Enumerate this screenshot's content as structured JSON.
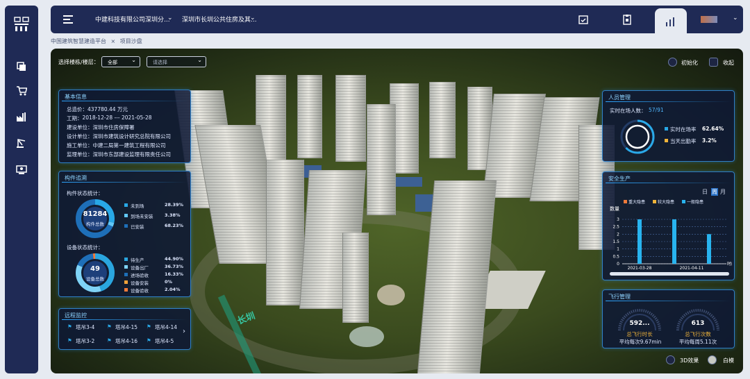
{
  "topbar": {
    "company": "中建科技有限公司深圳分...",
    "project": "深圳市长圳公共住房及其...",
    "user_name": ""
  },
  "breadcrumb": {
    "root": "中国建筑智慧建造平台",
    "sep": "×",
    "current": "项目沙盘"
  },
  "filter": {
    "label": "选择楼栋/楼层：",
    "building_value": "全部",
    "floor_placeholder": "请选择"
  },
  "controls": {
    "init_label": "初始化",
    "collapse_label": "收起",
    "effect_label": "3D效果",
    "white_label": "白模"
  },
  "basic_info": {
    "title": "基本信息",
    "rows": [
      {
        "k": "总造价：",
        "v": "437780.44 万元"
      },
      {
        "k": "工期：",
        "v": "2018-12-28 --- 2021-05-28"
      },
      {
        "k": "建设单位：",
        "v": "深圳市住房保障署"
      },
      {
        "k": "设计单位：",
        "v": "深圳市建筑设计研究总院有限公司"
      },
      {
        "k": "施工单位：",
        "v": "中建二局第一建筑工程有限公司"
      },
      {
        "k": "监理单位：",
        "v": "深圳市东部建设监理有限责任公司"
      }
    ]
  },
  "components": {
    "title": "构件追溯",
    "comp_label": "构件状态统计：",
    "comp_total": "81284",
    "comp_total_label": "构件总数",
    "comp_items": [
      {
        "name": "未到场",
        "pct": "28.39%",
        "color": "#28a8e6"
      },
      {
        "name": "到场未安装",
        "pct": "3.38%",
        "color": "#62c8f7"
      },
      {
        "name": "已安装",
        "pct": "68.23%",
        "color": "#1e6fb8"
      }
    ],
    "equip_label": "设备状态统计：",
    "equip_total": "49",
    "equip_total_label": "设备总数",
    "equip_items": [
      {
        "name": "待生产",
        "pct": "44.90%",
        "color": "#2aa6df"
      },
      {
        "name": "设备出厂",
        "pct": "36.73%",
        "color": "#7fd3f6"
      },
      {
        "name": "进场验收",
        "pct": "16.33%",
        "color": "#1e6fb8"
      },
      {
        "name": "设备安装",
        "pct": "0%",
        "color": "#f0a23a"
      },
      {
        "name": "设备验收",
        "pct": "2.04%",
        "color": "#f07a3a"
      }
    ]
  },
  "remote": {
    "title": "远程监控",
    "cranes": [
      "塔吊3-4",
      "塔吊4-15",
      "塔吊4-14",
      "塔吊3-2",
      "塔吊4-16",
      "塔吊4-5"
    ]
  },
  "personnel": {
    "title": "人员管理",
    "onsite_label": "实时在场人数：",
    "onsite_value": "57/91",
    "onsite_fraction": 0.6264,
    "items": [
      {
        "name": "实时在场率",
        "value": "62.64%",
        "color": "#28a8e6"
      },
      {
        "name": "当天出勤率",
        "value": "3.2%",
        "color": "#f0b43a"
      }
    ]
  },
  "safety": {
    "title": "安全生产",
    "tabs": [
      "日",
      "周",
      "月"
    ],
    "active_tab": "周"
  },
  "chart_data": {
    "type": "bar",
    "legend": [
      {
        "name": "重大隐患",
        "color": "#f07a3a"
      },
      {
        "name": "较大隐患",
        "color": "#f0b43a"
      },
      {
        "name": "一般隐患",
        "color": "#28b4ef"
      }
    ],
    "ylabel": "数量",
    "xlabel": "时间",
    "ylim": [
      0,
      3
    ],
    "yticks": [
      "0",
      "0.5",
      "1",
      "1.5",
      "2",
      "2.5",
      "3"
    ],
    "xticks": [
      "2021-03-28",
      "2021-04-11"
    ],
    "series": [
      {
        "name": "一般隐患",
        "values": [
          3,
          3,
          2
        ]
      }
    ]
  },
  "flight": {
    "title": "飞行管理",
    "duration_value": "592...",
    "duration_label": "总飞行时长",
    "duration_avg": "平均每次9.67min",
    "count_value": "613",
    "count_label": "总飞行次数",
    "count_avg": "平均每周5.11次"
  },
  "scene": {
    "sign_text": "长圳"
  }
}
